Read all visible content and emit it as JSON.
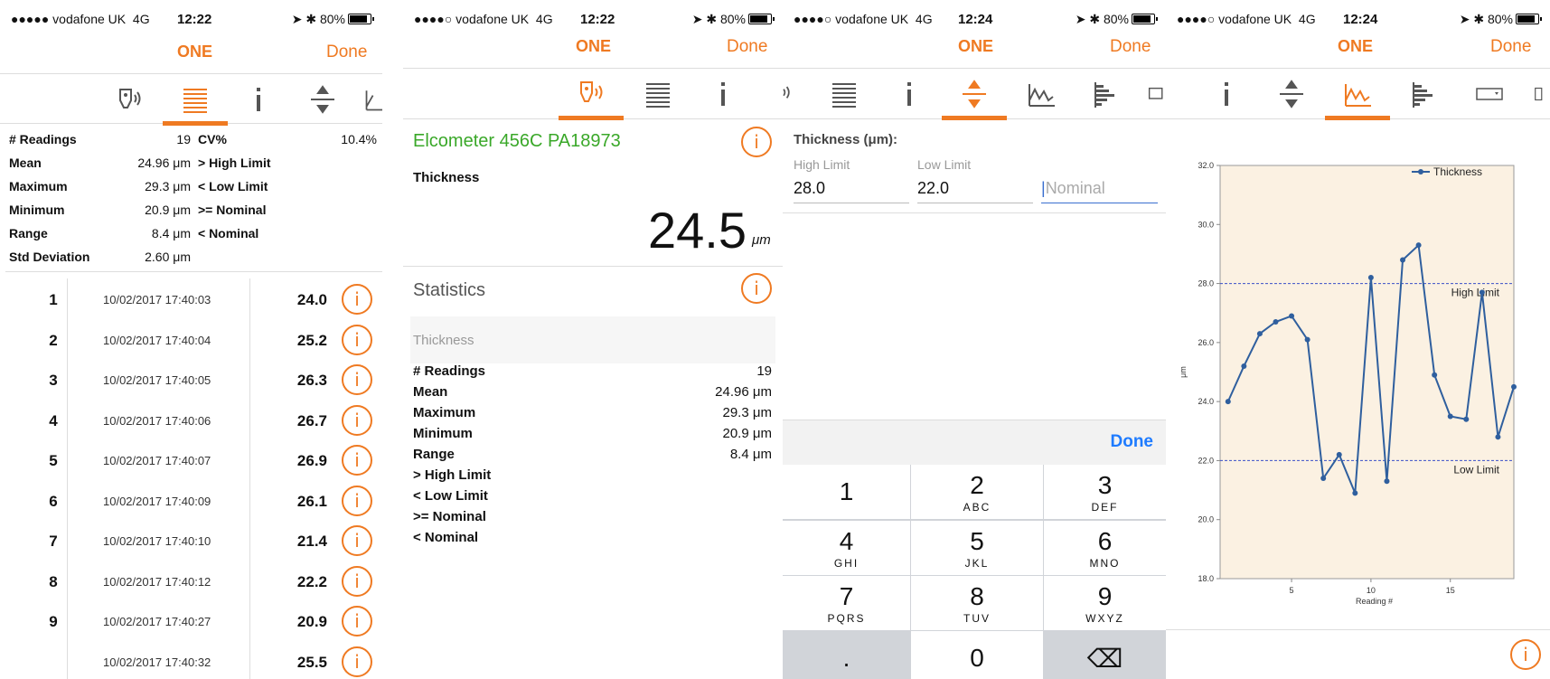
{
  "screens": [
    {
      "status": {
        "carrier": "●●●●● vodafone UK",
        "net": "4G",
        "time": "12:22",
        "battery": "80%"
      },
      "nav": {
        "title": "ONE",
        "done": "Done"
      },
      "stats_left": [
        {
          "label": "# Readings",
          "value": "19"
        },
        {
          "label": "Mean",
          "value": "24.96 μm"
        },
        {
          "label": "Maximum",
          "value": "29.3 μm"
        },
        {
          "label": "Minimum",
          "value": "20.9 μm"
        },
        {
          "label": "Range",
          "value": "8.4 μm"
        },
        {
          "label": "Std Deviation",
          "value": "2.60 μm"
        }
      ],
      "stats_right": [
        {
          "label": "CV%",
          "value": "10.4%"
        },
        {
          "label": "> High Limit",
          "value": ""
        },
        {
          "label": "< Low Limit",
          "value": ""
        },
        {
          "label": ">= Nominal",
          "value": ""
        },
        {
          "label": "< Nominal",
          "value": ""
        }
      ],
      "readings": [
        {
          "idx": "1",
          "date": "10/02/2017 17:40:03",
          "value": "24.0"
        },
        {
          "idx": "2",
          "date": "10/02/2017 17:40:04",
          "value": "25.2"
        },
        {
          "idx": "3",
          "date": "10/02/2017 17:40:05",
          "value": "26.3"
        },
        {
          "idx": "4",
          "date": "10/02/2017 17:40:06",
          "value": "26.7"
        },
        {
          "idx": "5",
          "date": "10/02/2017 17:40:07",
          "value": "26.9"
        },
        {
          "idx": "6",
          "date": "10/02/2017 17:40:09",
          "value": "26.1"
        },
        {
          "idx": "7",
          "date": "10/02/2017 17:40:10",
          "value": "21.4"
        },
        {
          "idx": "8",
          "date": "10/02/2017 17:40:12",
          "value": "22.2"
        },
        {
          "idx": "9",
          "date": "10/02/2017 17:40:27",
          "value": "20.9"
        },
        {
          "idx": "",
          "date": "10/02/2017 17:40:32",
          "value": "25.5"
        }
      ],
      "info_glyph": "i"
    },
    {
      "status": {
        "carrier": "●●●●○ vodafone UK",
        "net": "4G",
        "time": "12:22",
        "battery": "80%"
      },
      "nav": {
        "title": "ONE",
        "done": "Done"
      },
      "gauge": {
        "name": "Elcometer 456C PA18973",
        "label": "Thickness",
        "reading": "24.5",
        "unit": "μm"
      },
      "statistics": {
        "heading": "Statistics",
        "subheading": "Thickness",
        "rows": [
          {
            "label": "# Readings",
            "value": "19"
          },
          {
            "label": "Mean",
            "value": "24.96 μm"
          },
          {
            "label": "Maximum",
            "value": "29.3 μm"
          },
          {
            "label": "Minimum",
            "value": "20.9 μm"
          },
          {
            "label": "Range",
            "value": "8.4 μm"
          },
          {
            "label": "> High Limit",
            "value": ""
          },
          {
            "label": "< Low Limit",
            "value": ""
          },
          {
            "label": ">= Nominal",
            "value": ""
          },
          {
            "label": "< Nominal",
            "value": ""
          }
        ]
      },
      "info_glyph": "i"
    },
    {
      "status": {
        "carrier": "●●●●○ vodafone UK",
        "net": "4G",
        "time": "12:24",
        "battery": "80%"
      },
      "nav": {
        "title": "ONE",
        "done": "Done"
      },
      "limits": {
        "title": "Thickness (μm):",
        "high_label": "High Limit",
        "high_value": "28.0",
        "low_label": "Low Limit",
        "low_value": "22.0",
        "nominal_placeholder": "Nominal"
      },
      "keyboard": {
        "done": "Done",
        "keys": [
          {
            "d": "1",
            "l": ""
          },
          {
            "d": "2",
            "l": "ABC"
          },
          {
            "d": "3",
            "l": "DEF"
          },
          {
            "d": "4",
            "l": "GHI"
          },
          {
            "d": "5",
            "l": "JKL"
          },
          {
            "d": "6",
            "l": "MNO"
          },
          {
            "d": "7",
            "l": "PQRS"
          },
          {
            "d": "8",
            "l": "TUV"
          },
          {
            "d": "9",
            "l": "WXYZ"
          },
          {
            "d": ".",
            "l": ""
          },
          {
            "d": "0",
            "l": ""
          },
          {
            "d": "⌫",
            "l": ""
          }
        ]
      }
    },
    {
      "status": {
        "carrier": "●●●●○ vodafone UK",
        "net": "4G",
        "time": "12:24",
        "battery": "80%"
      },
      "nav": {
        "title": "ONE",
        "done": "Done"
      },
      "info_glyph": "i",
      "chart_data": {
        "type": "line",
        "series": [
          {
            "name": "Thickness",
            "x": [
              1,
              2,
              3,
              4,
              5,
              6,
              7,
              8,
              9,
              10,
              11,
              12,
              13,
              14,
              15,
              16,
              17,
              18,
              19
            ],
            "values": [
              24.0,
              25.2,
              26.3,
              26.7,
              26.9,
              26.1,
              21.4,
              22.2,
              20.9,
              28.2,
              21.3,
              28.8,
              29.3,
              24.9,
              23.5,
              23.4,
              27.7,
              22.8,
              24.5
            ]
          }
        ],
        "xlabel": "Reading #",
        "ylabel": "μm",
        "xlim": [
          0.5,
          19
        ],
        "ylim": [
          18.0,
          32.0
        ],
        "xticks": [
          5,
          10,
          15
        ],
        "yticks": [
          "18.0",
          "20.0",
          "22.0",
          "24.0",
          "26.0",
          "28.0",
          "30.0",
          "32.0"
        ],
        "reference_lines": [
          {
            "label": "High Limit",
            "value": 28.0
          },
          {
            "label": "Low Limit",
            "value": 22.0
          }
        ],
        "legend": "top-right",
        "grid": false,
        "colors": {
          "line": "#2f5f9e",
          "plot_bg": "#fbf1e2",
          "limit": "#3a4fc8"
        }
      }
    }
  ],
  "theme": {
    "accent": "#ef7a22",
    "green": "#3aa829",
    "blue": "#1e7bff"
  }
}
